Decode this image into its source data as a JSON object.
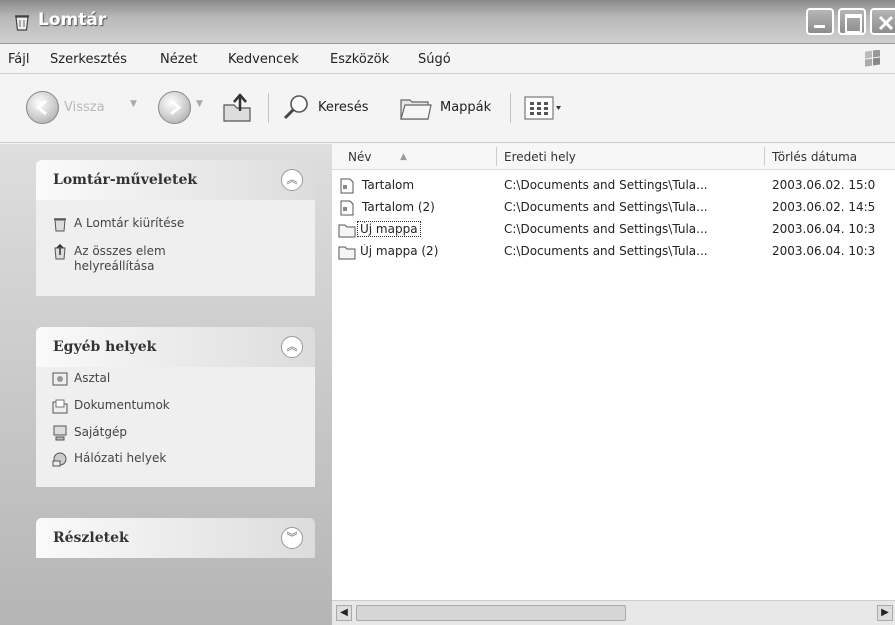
{
  "window": {
    "title": "Lomtár"
  },
  "menu": [
    "Fájl",
    "Szerkesztés",
    "Nézet",
    "Kedvencek",
    "Eszközök",
    "Súgó"
  ],
  "toolbar": {
    "back": "Vissza",
    "search": "Keresés",
    "folders": "Mappák"
  },
  "tasks_panel": {
    "title": "Lomtár-műveletek",
    "items": [
      {
        "label": "A Lomtár kiürítése",
        "icon": "empty-bin-icon"
      },
      {
        "label_line1": "Az összes elem",
        "label_line2": "helyreállítása",
        "icon": "restore-all-icon"
      }
    ]
  },
  "places_panel": {
    "title": "Egyéb helyek",
    "items": [
      {
        "label": "Asztal",
        "icon": "desktop-icon"
      },
      {
        "label": "Dokumentumok",
        "icon": "documents-folder-icon"
      },
      {
        "label": "Sajátgép",
        "icon": "my-computer-icon"
      },
      {
        "label": "Hálózati helyek",
        "icon": "network-places-icon"
      }
    ]
  },
  "details_panel": {
    "title": "Részletek"
  },
  "list": {
    "columns": [
      "Név",
      "Eredeti hely",
      "Törlés dátuma"
    ],
    "rows": [
      {
        "name": "Tartalom",
        "location": "C:\\Documents and Settings\\Tula...",
        "date": "2003.06.02. 15:0",
        "icon": "document-icon"
      },
      {
        "name": "Tartalom (2)",
        "location": "C:\\Documents and Settings\\Tula...",
        "date": "2003.06.02. 14:5",
        "icon": "document-icon"
      },
      {
        "name": "Új mappa",
        "location": "C:\\Documents and Settings\\Tula...",
        "date": "2003.06.04. 10:3",
        "icon": "folder-icon"
      },
      {
        "name": "Új mappa (2)",
        "location": "C:\\Documents and Settings\\Tula...",
        "date": "2003.06.04. 10:3",
        "icon": "folder-icon"
      }
    ]
  }
}
